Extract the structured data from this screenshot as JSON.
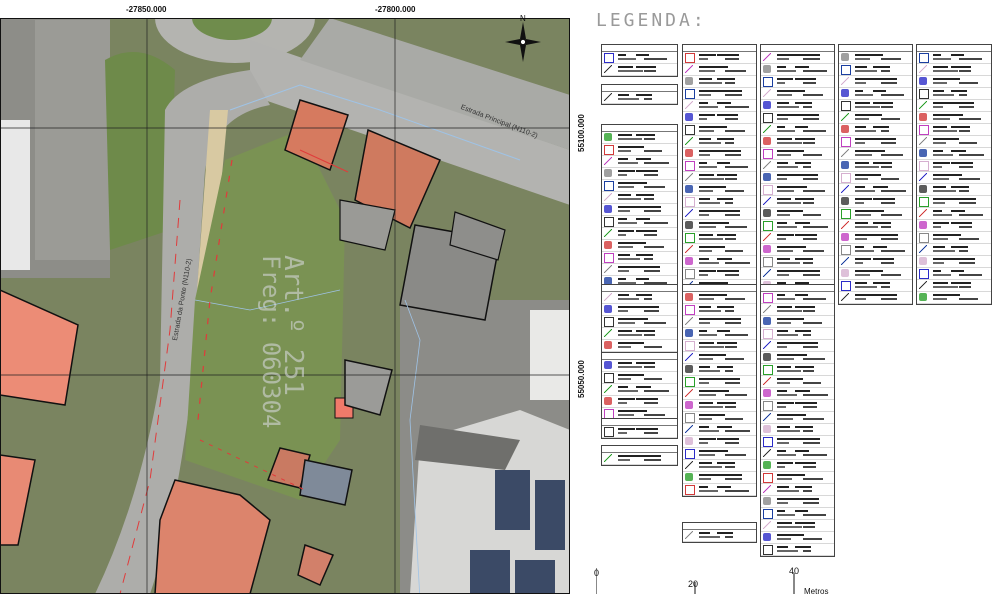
{
  "grid": {
    "x_labels": [
      "-27850.000",
      "-27800.000"
    ],
    "y_labels": [
      "55100.000",
      "55050.000"
    ]
  },
  "north_arrow": {
    "label": "N",
    "icon": "compass-rose-icon"
  },
  "roads": {
    "principal": "Estrada Principal (N110-2)",
    "ponte": "Estrada da Ponte (N110-2)"
  },
  "parcel": {
    "article": "Art.º 251",
    "freguesia": "Freg: 060304"
  },
  "legend": {
    "title": "LEGENDA:"
  },
  "scale": {
    "ticks": [
      "0",
      "20",
      "40"
    ],
    "unit": "Metros"
  },
  "colors": {
    "roof": "#e07a62",
    "road": "#a8a8a8",
    "grass": "#7f8f58",
    "boundary": "#111111",
    "cadastre": "#d63b3b"
  }
}
